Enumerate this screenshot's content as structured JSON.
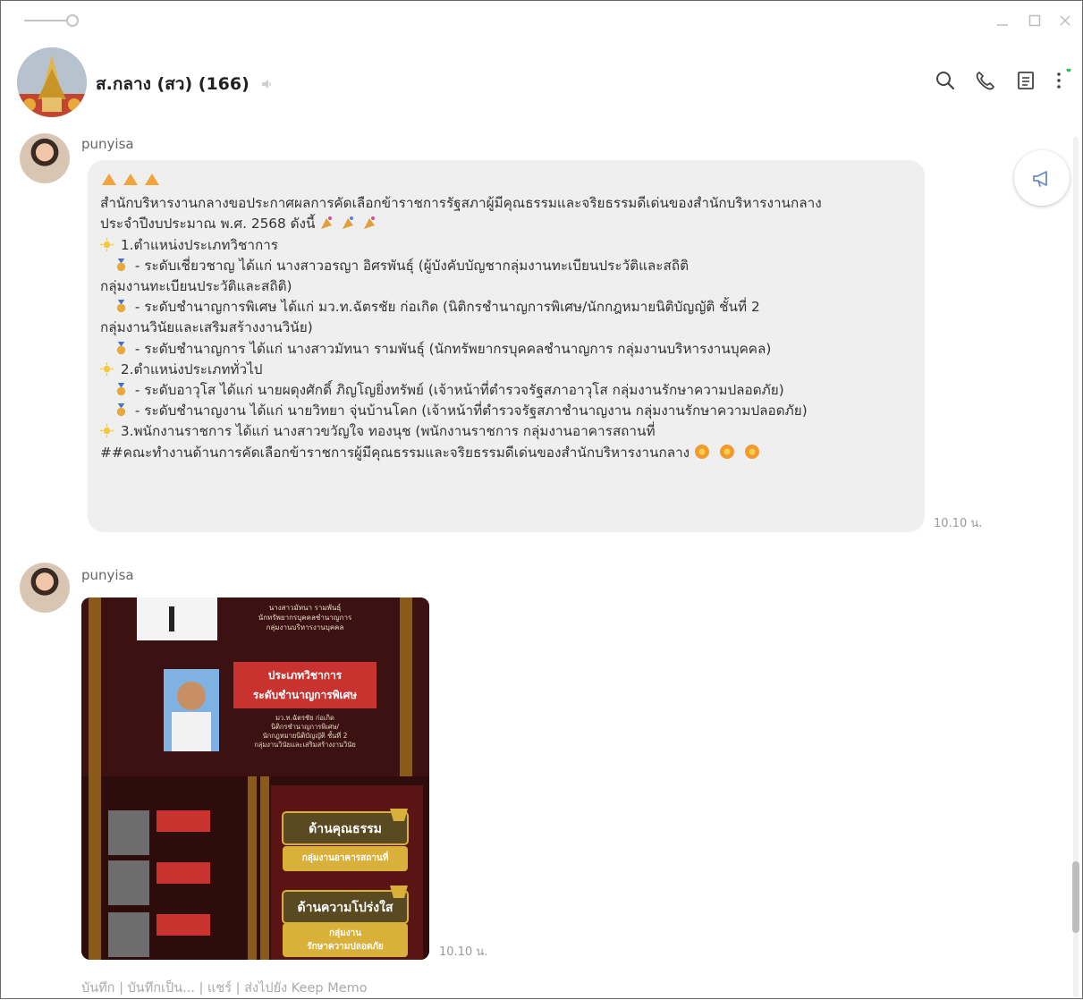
{
  "header": {
    "group_name": "ส.กลาง (สว) (166)"
  },
  "messages": [
    {
      "sender": "punyisa",
      "time": "10.10 น.",
      "lines": [
        "",
        "สำนักบริหารงานกลางขอประกาศผลการคัดเลือกข้าราชการรัฐสภาผู้มีคุณธรรมและจริยธรรมดีเด่นของสำนักบริหารงานกลาง",
        "ประจำปีงบประมาณ พ.ศ. 2568 ดังนี้",
        "1.ตำแหน่งประเภทวิชาการ",
        "- ระดับเชี่ยวชาญ ได้แก่ นางสาวอรญา อิศรพันธุ์ (ผู้บังคับบัญชากลุ่มงานทะเบียนประวัติและสถิติ",
        "กลุ่มงานทะเบียนประวัติและสถิติ)",
        "- ระดับชำนาญการพิเศษ ได้แก่ มว.ท.ฉัตรชัย ก่อเกิด (นิติกรชำนาญการพิเศษ/นักกฎหมายนิติบัญญัติ ชั้นที่ 2",
        "กลุ่มงานวินัยและเสริมสร้างงานวินัย)",
        "- ระดับชำนาญการ ได้แก่ นางสาวมัทนา รามพันธุ์ (นักทรัพยากรบุคคลชำนาญการ กลุ่มงานบริหารงานบุคคล)",
        "2.ตำแหน่งประเภททั่วไป",
        "- ระดับอาวุโส ได้แก่ นายผดุงศักดิ์ ภิญโญยิ่งทรัพย์ (เจ้าหน้าที่ตำรวจรัฐสภาอาวุโส กลุ่มงานรักษาความปลอดภัย)",
        "- ระดับชำนาญงาน ได้แก่ นายวิทยา จุ่นบ้านโคก (เจ้าหน้าที่ตำรวจรัฐสภาชำนาญงาน กลุ่มงานรักษาความปลอดภัย)",
        "3.พนักงานราชการ ได้แก่ นางสาวขวัญใจ ทองนุช (พนักงานราชการ กลุ่มงานอาคารสถานที่",
        "##คณะทำงานด้านการคัดเลือกข้าราชการผู้มีคุณธรรมและจริยธรรมดีเด่นของสำนักบริหารงานกลาง"
      ]
    },
    {
      "sender": "punyisa",
      "time": "10.10 น.",
      "image_text": {
        "top_caption_1": "นางสาวมัทนา รามพันธุ์",
        "top_caption_2": "นักทรัพยากรบุคคลชำนาญการ",
        "top_caption_3": "กลุ่มงานบริหารงานบุคคล",
        "banner_1": "ประเภทวิชาการ",
        "banner_2": "ระดับชำนาญการพิเศษ",
        "mid_caption_1": "มว.ท.ฉัตรชัย ก่อเกิด",
        "mid_caption_2": "นิติกรชำนาญการพิเศษ/",
        "mid_caption_3": "นักกฎหมายนิติบัญญัติ ชั้นที่ 2",
        "mid_caption_4": "กลุ่มงานวินัยและเสริมสร้างงานวินัย",
        "award_1": "ด้านคุณธรรม",
        "award_1_sub": "กลุ่มงานอาคารสถานที่",
        "award_2": "ด้านความโปร่งใส",
        "award_2_sub_1": "กลุ่มงาน",
        "award_2_sub_2": "รักษาความปลอดภัย"
      }
    }
  ],
  "actions": [
    "บันทึก",
    "บันทึกเป็น...",
    "แชร์",
    "ส่งไปยัง Keep Memo"
  ]
}
